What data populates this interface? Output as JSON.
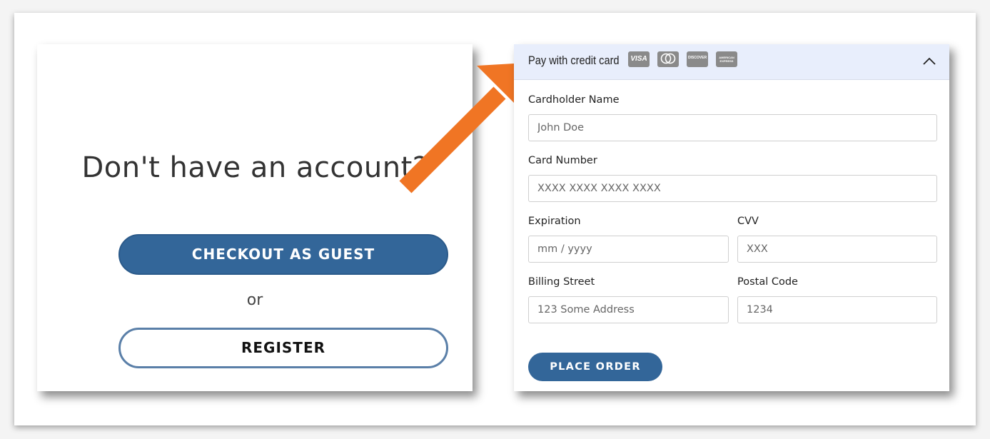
{
  "account": {
    "title": "Don't have an account?",
    "guest_button": "CHECKOUT AS GUEST",
    "or_text": "or",
    "register_button": "REGISTER"
  },
  "payment": {
    "header_title": "Pay with credit card",
    "card_icons": [
      "visa-icon",
      "mastercard-icon",
      "discover-icon",
      "amex-icon"
    ],
    "card_icon_labels": [
      "VISA",
      "",
      "DISCOVER",
      "AMERICAN EXPRESS"
    ],
    "fields": {
      "cardholder_name": {
        "label": "Cardholder Name",
        "placeholder": "John Doe"
      },
      "card_number": {
        "label": "Card Number",
        "placeholder": "XXXX XXXX XXXX XXXX"
      },
      "expiration": {
        "label": "Expiration",
        "placeholder": "mm / yyyy"
      },
      "cvv": {
        "label": "CVV",
        "placeholder": "XXX"
      },
      "billing_street": {
        "label": "Billing Street",
        "placeholder": "123 Some Address"
      },
      "postal_code": {
        "label": "Postal Code",
        "placeholder": "1234"
      }
    },
    "place_order_button": "PLACE ORDER"
  },
  "colors": {
    "primary": "#336699",
    "arrow": "#f07524",
    "header_bg": "#e8eefc"
  }
}
